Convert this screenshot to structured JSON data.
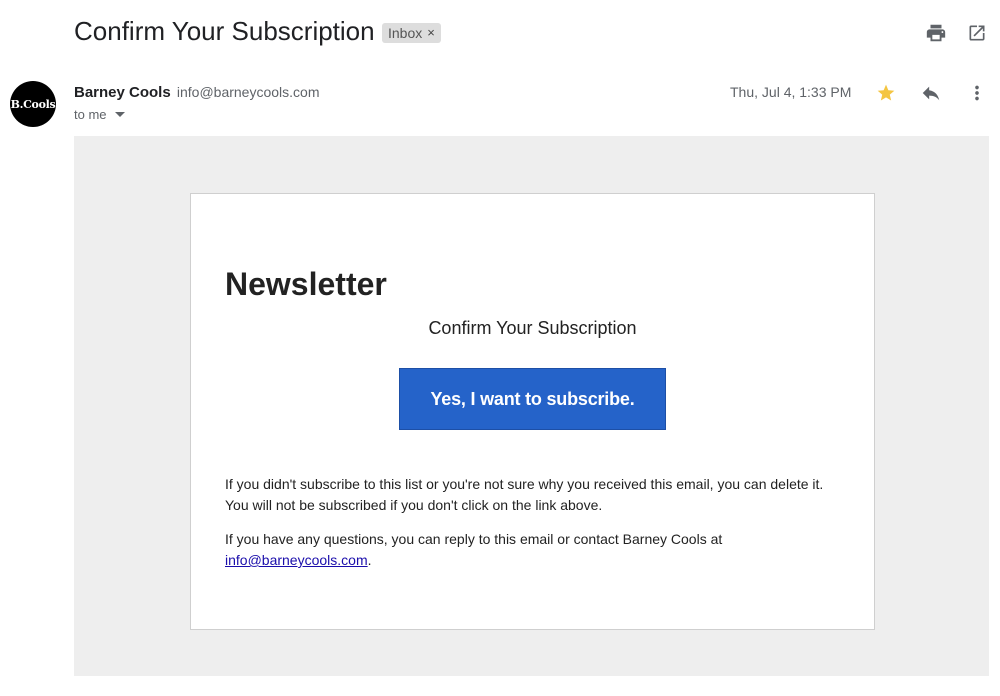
{
  "email": {
    "subject": "Confirm Your Subscription",
    "label": "Inbox",
    "label_remove": "×",
    "sender_name": "Barney Cools",
    "sender_email": "info@barneycools.com",
    "recipient": "to me",
    "timestamp": "Thu, Jul 4, 1:33 PM",
    "avatar_text": "B.Cools",
    "starred": true
  },
  "icons": {
    "print": "print-icon",
    "open_new": "open-in-new-window-icon",
    "star": "star-icon",
    "reply": "reply-icon",
    "more": "more-vertical-icon",
    "caret": "chevron-down-icon"
  },
  "body": {
    "heading": "Newsletter",
    "subheading": "Confirm Your Subscription",
    "cta_label": "Yes, I want to subscribe.",
    "para1": "If you didn't subscribe to this list or you're not sure why you received this email, you can delete it. You will not be subscribed if you don't click on the link above.",
    "para2_prefix": "If you have any questions, you can reply to this email or contact Barney Cools at",
    "para2_link": "info@barneycools.com",
    "para2_suffix": "."
  },
  "colors": {
    "cta": "#2563c9",
    "star": "#f4c542",
    "background": "#eeeeee",
    "link": "#1a0dab"
  }
}
